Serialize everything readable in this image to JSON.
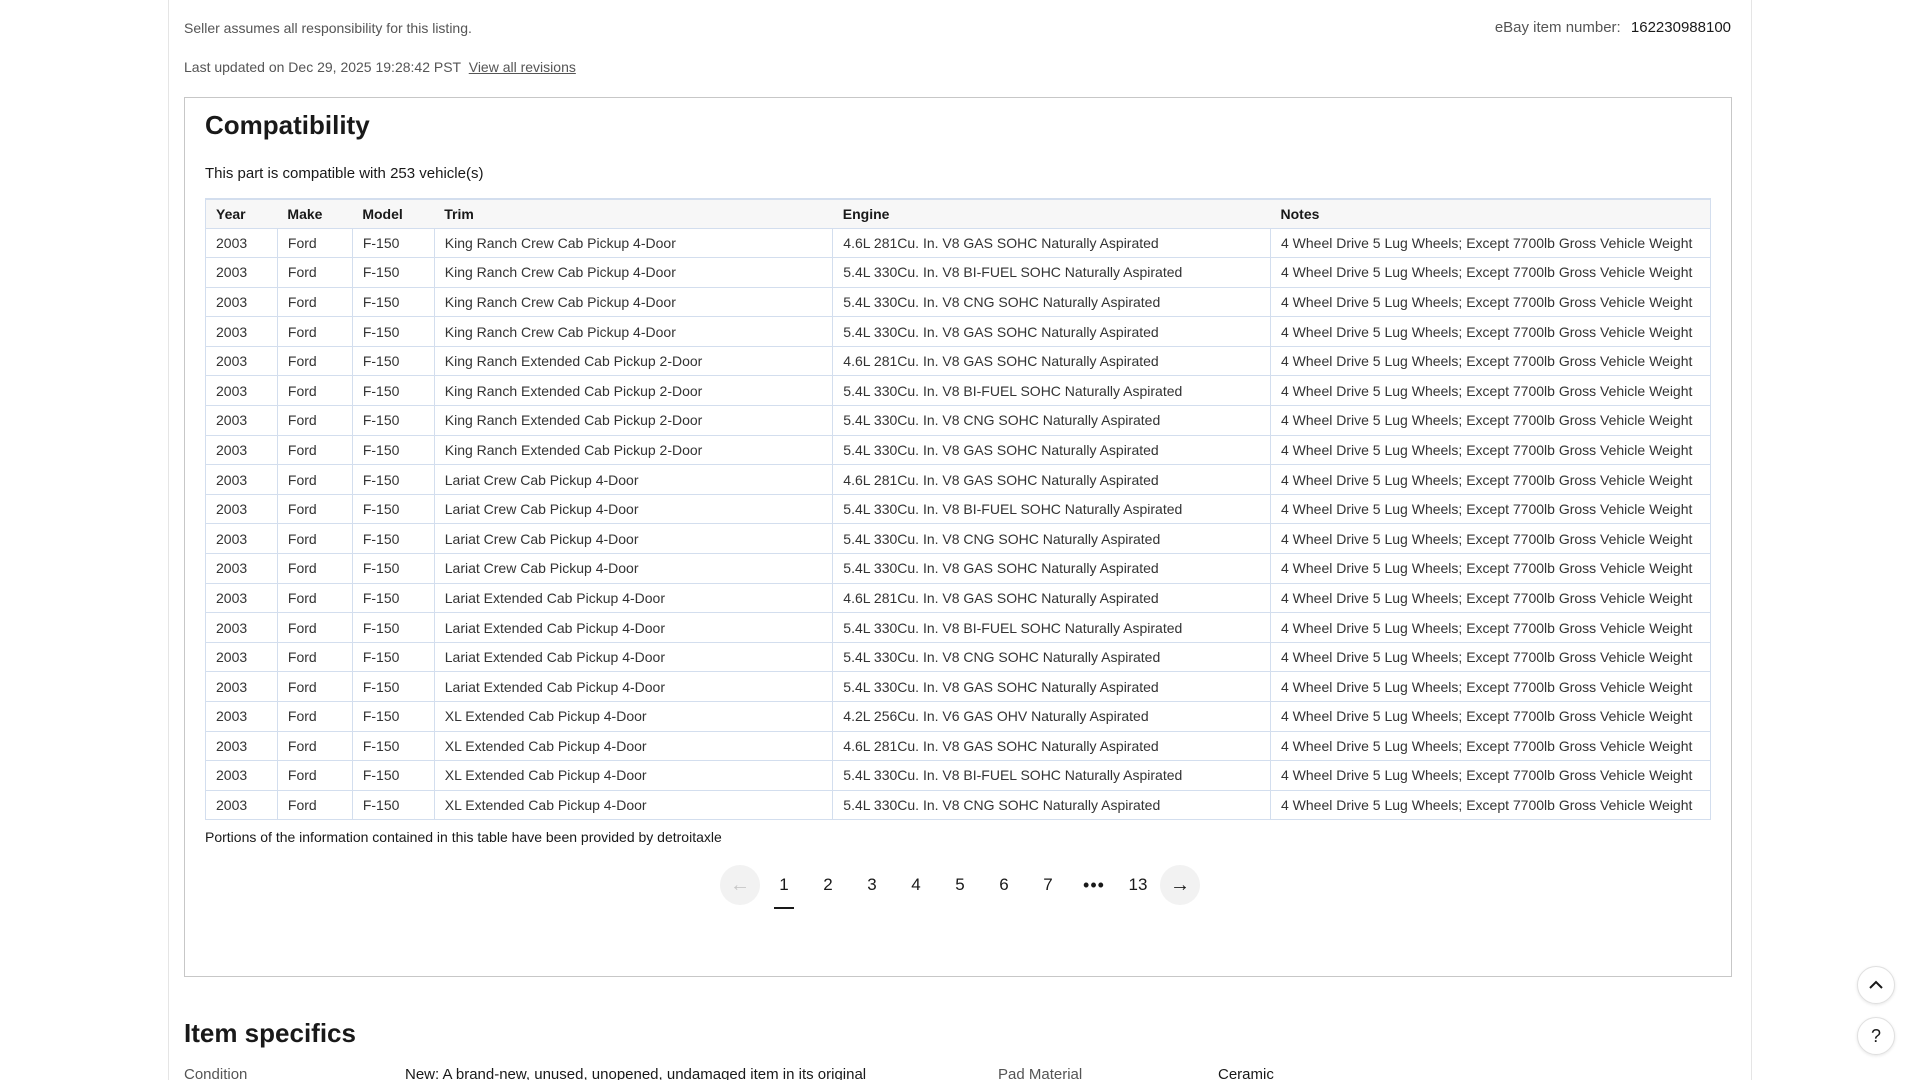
{
  "header": {
    "seller_note": "Seller assumes all responsibility for this listing.",
    "item_number_label": "eBay item number:",
    "item_number": "162230988100",
    "last_updated": "Last updated on Dec 29, 2025 19:28:42 PST",
    "view_revisions": "View all revisions"
  },
  "compatibility": {
    "title": "Compatibility",
    "subtitle": "This part is compatible with 253 vehicle(s)",
    "columns": [
      "Year",
      "Make",
      "Model",
      "Trim",
      "Engine",
      "Notes"
    ],
    "rows": [
      [
        "2003",
        "Ford",
        "F-150",
        "King Ranch Crew Cab Pickup 4-Door",
        "4.6L 281Cu. In. V8 GAS SOHC Naturally Aspirated",
        "4 Wheel Drive 5 Lug Wheels; Except 7700lb Gross Vehicle Weight"
      ],
      [
        "2003",
        "Ford",
        "F-150",
        "King Ranch Crew Cab Pickup 4-Door",
        "5.4L 330Cu. In. V8 BI-FUEL SOHC Naturally Aspirated",
        "4 Wheel Drive 5 Lug Wheels; Except 7700lb Gross Vehicle Weight"
      ],
      [
        "2003",
        "Ford",
        "F-150",
        "King Ranch Crew Cab Pickup 4-Door",
        "5.4L 330Cu. In. V8 CNG SOHC Naturally Aspirated",
        "4 Wheel Drive 5 Lug Wheels; Except 7700lb Gross Vehicle Weight"
      ],
      [
        "2003",
        "Ford",
        "F-150",
        "King Ranch Crew Cab Pickup 4-Door",
        "5.4L 330Cu. In. V8 GAS SOHC Naturally Aspirated",
        "4 Wheel Drive 5 Lug Wheels; Except 7700lb Gross Vehicle Weight"
      ],
      [
        "2003",
        "Ford",
        "F-150",
        "King Ranch Extended Cab Pickup 2-Door",
        "4.6L 281Cu. In. V8 GAS SOHC Naturally Aspirated",
        "4 Wheel Drive 5 Lug Wheels; Except 7700lb Gross Vehicle Weight"
      ],
      [
        "2003",
        "Ford",
        "F-150",
        "King Ranch Extended Cab Pickup 2-Door",
        "5.4L 330Cu. In. V8 BI-FUEL SOHC Naturally Aspirated",
        "4 Wheel Drive 5 Lug Wheels; Except 7700lb Gross Vehicle Weight"
      ],
      [
        "2003",
        "Ford",
        "F-150",
        "King Ranch Extended Cab Pickup 2-Door",
        "5.4L 330Cu. In. V8 CNG SOHC Naturally Aspirated",
        "4 Wheel Drive 5 Lug Wheels; Except 7700lb Gross Vehicle Weight"
      ],
      [
        "2003",
        "Ford",
        "F-150",
        "King Ranch Extended Cab Pickup 2-Door",
        "5.4L 330Cu. In. V8 GAS SOHC Naturally Aspirated",
        "4 Wheel Drive 5 Lug Wheels; Except 7700lb Gross Vehicle Weight"
      ],
      [
        "2003",
        "Ford",
        "F-150",
        "Lariat Crew Cab Pickup 4-Door",
        "4.6L 281Cu. In. V8 GAS SOHC Naturally Aspirated",
        "4 Wheel Drive 5 Lug Wheels; Except 7700lb Gross Vehicle Weight"
      ],
      [
        "2003",
        "Ford",
        "F-150",
        "Lariat Crew Cab Pickup 4-Door",
        "5.4L 330Cu. In. V8 BI-FUEL SOHC Naturally Aspirated",
        "4 Wheel Drive 5 Lug Wheels; Except 7700lb Gross Vehicle Weight"
      ],
      [
        "2003",
        "Ford",
        "F-150",
        "Lariat Crew Cab Pickup 4-Door",
        "5.4L 330Cu. In. V8 CNG SOHC Naturally Aspirated",
        "4 Wheel Drive 5 Lug Wheels; Except 7700lb Gross Vehicle Weight"
      ],
      [
        "2003",
        "Ford",
        "F-150",
        "Lariat Crew Cab Pickup 4-Door",
        "5.4L 330Cu. In. V8 GAS SOHC Naturally Aspirated",
        "4 Wheel Drive 5 Lug Wheels; Except 7700lb Gross Vehicle Weight"
      ],
      [
        "2003",
        "Ford",
        "F-150",
        "Lariat Extended Cab Pickup 4-Door",
        "4.6L 281Cu. In. V8 GAS SOHC Naturally Aspirated",
        "4 Wheel Drive 5 Lug Wheels; Except 7700lb Gross Vehicle Weight"
      ],
      [
        "2003",
        "Ford",
        "F-150",
        "Lariat Extended Cab Pickup 4-Door",
        "5.4L 330Cu. In. V8 BI-FUEL SOHC Naturally Aspirated",
        "4 Wheel Drive 5 Lug Wheels; Except 7700lb Gross Vehicle Weight"
      ],
      [
        "2003",
        "Ford",
        "F-150",
        "Lariat Extended Cab Pickup 4-Door",
        "5.4L 330Cu. In. V8 CNG SOHC Naturally Aspirated",
        "4 Wheel Drive 5 Lug Wheels; Except 7700lb Gross Vehicle Weight"
      ],
      [
        "2003",
        "Ford",
        "F-150",
        "Lariat Extended Cab Pickup 4-Door",
        "5.4L 330Cu. In. V8 GAS SOHC Naturally Aspirated",
        "4 Wheel Drive 5 Lug Wheels; Except 7700lb Gross Vehicle Weight"
      ],
      [
        "2003",
        "Ford",
        "F-150",
        "XL Extended Cab Pickup 4-Door",
        "4.2L 256Cu. In. V6 GAS OHV Naturally Aspirated",
        "4 Wheel Drive 5 Lug Wheels; Except 7700lb Gross Vehicle Weight"
      ],
      [
        "2003",
        "Ford",
        "F-150",
        "XL Extended Cab Pickup 4-Door",
        "4.6L 281Cu. In. V8 GAS SOHC Naturally Aspirated",
        "4 Wheel Drive 5 Lug Wheels; Except 7700lb Gross Vehicle Weight"
      ],
      [
        "2003",
        "Ford",
        "F-150",
        "XL Extended Cab Pickup 4-Door",
        "5.4L 330Cu. In. V8 BI-FUEL SOHC Naturally Aspirated",
        "4 Wheel Drive 5 Lug Wheels; Except 7700lb Gross Vehicle Weight"
      ],
      [
        "2003",
        "Ford",
        "F-150",
        "XL Extended Cab Pickup 4-Door",
        "5.4L 330Cu. In. V8 CNG SOHC Naturally Aspirated",
        "4 Wheel Drive 5 Lug Wheels; Except 7700lb Gross Vehicle Weight"
      ]
    ],
    "portions_note": "Portions of the information contained in this table have been provided by detroitaxle"
  },
  "pagination": {
    "prev_icon": "arrow-left-icon",
    "next_icon": "arrow-right-icon",
    "current": "1",
    "pages": [
      "1",
      "2",
      "3",
      "4",
      "5",
      "6",
      "7"
    ],
    "ellipsis": "•••",
    "last": "13"
  },
  "item_specifics": {
    "title": "Item specifics",
    "condition_label": "Condition",
    "condition_value": "New: A brand-new, unused, unopened, undamaged item in its original",
    "pad_material_label": "Pad Material",
    "pad_material_value": "Ceramic"
  },
  "floating": {
    "scroll_top_icon": "chevron-up-icon",
    "help_icon": "help-icon",
    "help_glyph": "?"
  },
  "colors": {
    "table_border": "#d3deee",
    "header_bg": "#f7f7f7",
    "text": "#191919"
  }
}
